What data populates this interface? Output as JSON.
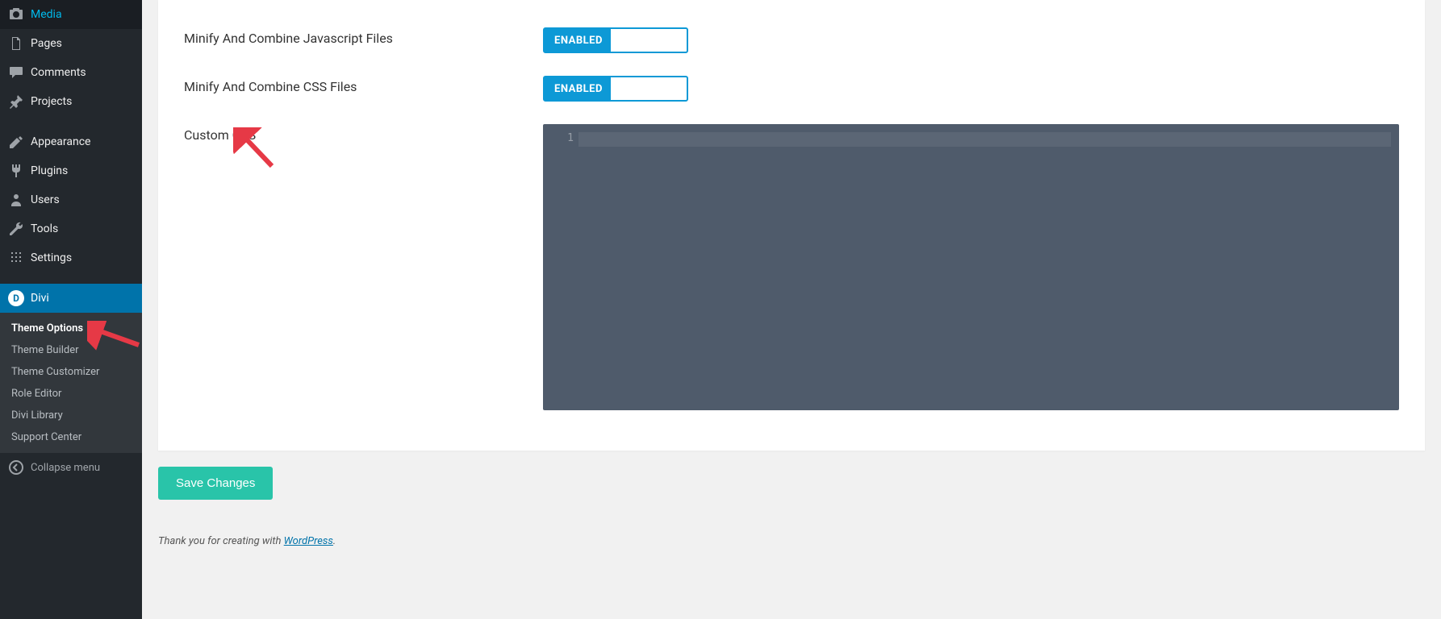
{
  "sidebar": {
    "items": [
      {
        "icon": "media",
        "label": "Media"
      },
      {
        "icon": "pages",
        "label": "Pages"
      },
      {
        "icon": "comments",
        "label": "Comments"
      },
      {
        "icon": "pin",
        "label": "Projects"
      }
    ],
    "items2": [
      {
        "icon": "appearance",
        "label": "Appearance"
      },
      {
        "icon": "plugins",
        "label": "Plugins"
      },
      {
        "icon": "users",
        "label": "Users"
      },
      {
        "icon": "tools",
        "label": "Tools"
      },
      {
        "icon": "settings",
        "label": "Settings"
      }
    ],
    "divi": {
      "label": "Divi",
      "badge": "D"
    },
    "submenu": [
      "Theme Options",
      "Theme Builder",
      "Theme Customizer",
      "Role Editor",
      "Divi Library",
      "Support Center"
    ],
    "collapse": "Collapse menu"
  },
  "settings": {
    "minify_js": {
      "label": "Minify And Combine Javascript Files",
      "state": "ENABLED"
    },
    "minify_css": {
      "label": "Minify And Combine CSS Files",
      "state": "ENABLED"
    },
    "custom_css": {
      "label": "Custom CSS",
      "line": "1"
    }
  },
  "save_button": "Save Changes",
  "footer": {
    "prefix": "Thank you for creating with ",
    "link": "WordPress",
    "suffix": "."
  }
}
